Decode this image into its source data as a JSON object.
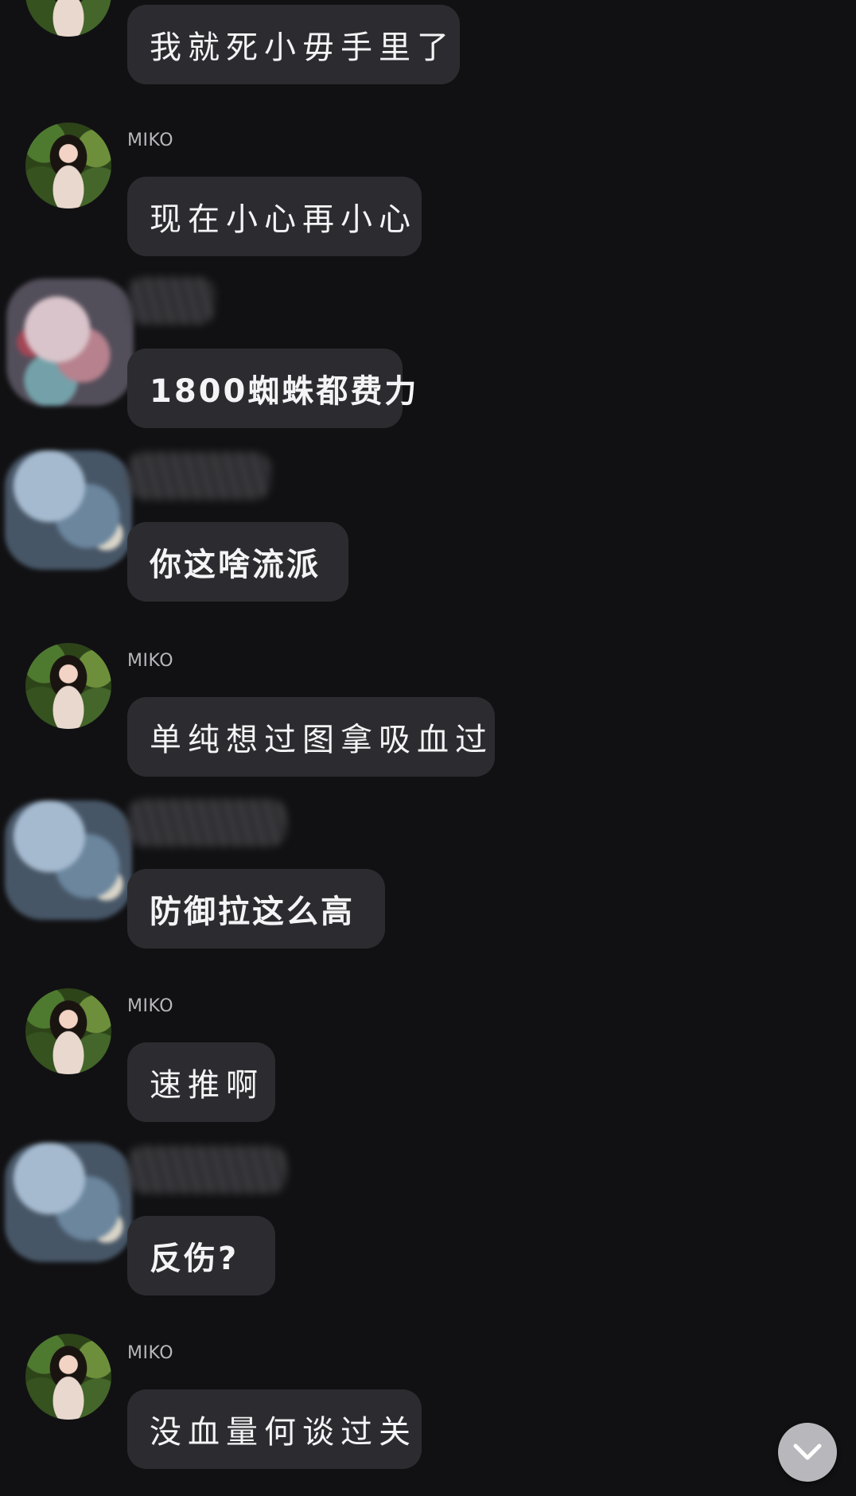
{
  "messages": [
    {
      "sender": "",
      "avatar": "miko-avatar",
      "text": "我就死小毋手里了"
    },
    {
      "sender": "MIKO",
      "avatar": "miko-avatar",
      "text": "现在小心再小心"
    },
    {
      "sender": "",
      "avatar": "blurred-avatar",
      "text": "1800蜘蛛都费力"
    },
    {
      "sender": "",
      "avatar": "blurred-avatar",
      "text": "你这啥流派"
    },
    {
      "sender": "MIKO",
      "avatar": "miko-avatar",
      "text": "单纯想过图拿吸血过"
    },
    {
      "sender": "",
      "avatar": "blurred-avatar",
      "text": "防御拉这么高"
    },
    {
      "sender": "MIKO",
      "avatar": "miko-avatar",
      "text": "速推啊"
    },
    {
      "sender": "",
      "avatar": "blurred-avatar",
      "text": "反伤?"
    },
    {
      "sender": "MIKO",
      "avatar": "miko-avatar",
      "text": "没血量何谈过关"
    }
  ],
  "scroll_button": {
    "icon": "chevron-down-icon"
  }
}
